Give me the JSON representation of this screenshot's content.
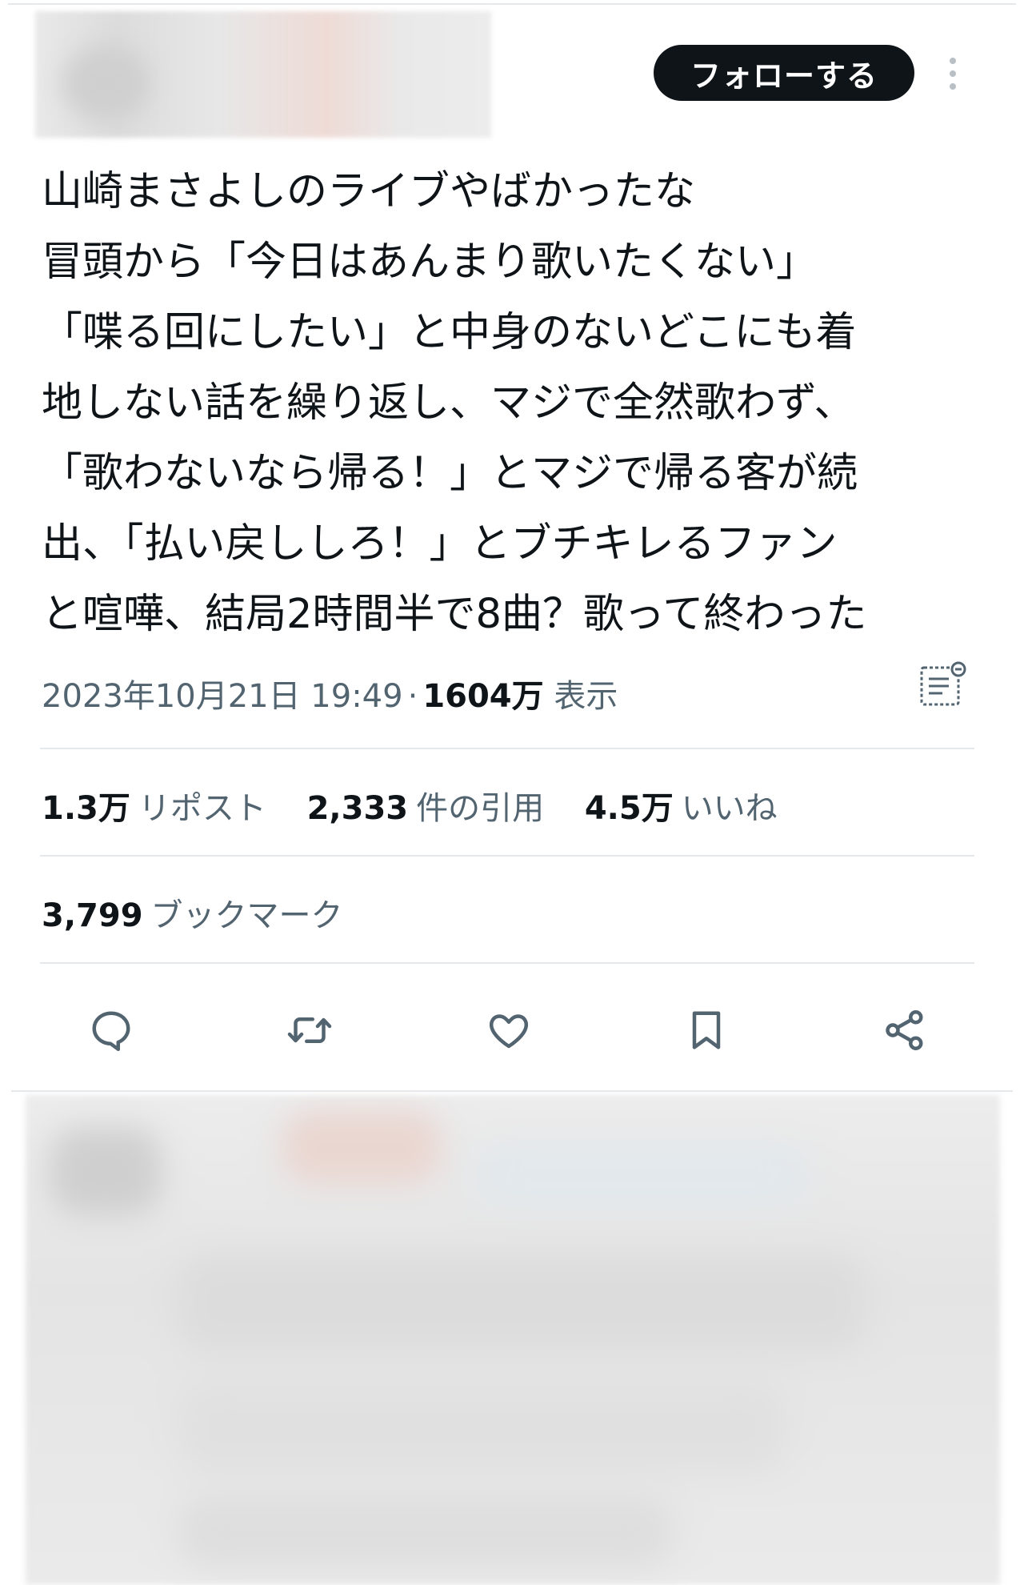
{
  "header": {
    "follow_label": "フォローする"
  },
  "tweet": {
    "lines": [
      "山崎まさよしのライブやばかったな",
      "冒頭から「今日はあんまり歌いたくない」",
      "「喋る回にしたい」と中身のないどこにも着",
      "地しない話を繰り返し、マジで全然歌わず、",
      "「歌わないなら帰る！」とマジで帰る客が続",
      "出、「払い戻ししろ！」とブチキレるファン",
      "と喧嘩、結局2時間半で8曲？歌って終わった"
    ],
    "timestamp": "2023年10月21日 19:49",
    "separator": "·",
    "views_count": "1604万",
    "views_label": "表示"
  },
  "stats": {
    "reposts_count": "1.3万",
    "reposts_label": "リポスト",
    "quotes_count": "2,333",
    "quotes_label": "件の引用",
    "likes_count": "4.5万",
    "likes_label": "いいね",
    "bookmarks_count": "3,799",
    "bookmarks_label": "ブックマーク"
  },
  "actions": [
    "reply-icon",
    "retweet-icon",
    "heart-icon",
    "bookmark-icon",
    "share-icon"
  ],
  "colors": {
    "text": "#0f1419",
    "secondary": "#536471",
    "icon": "#536471",
    "divider": "#e6e9ec",
    "button": "#0f1419"
  }
}
